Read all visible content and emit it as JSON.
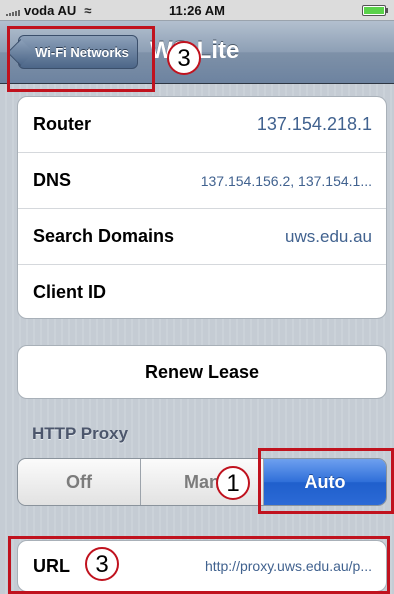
{
  "statusbar": {
    "carrier": "voda AU",
    "time": "11:26 AM"
  },
  "navbar": {
    "back_label": "Wi-Fi Networks",
    "title": "WS-Lite"
  },
  "rows": [
    {
      "label": "Router",
      "value": "137.154.218.1"
    },
    {
      "label": "DNS",
      "value": "137.154.156.2, 137.154.1..."
    },
    {
      "label": "Search Domains",
      "value": "uws.edu.au"
    },
    {
      "label": "Client ID",
      "value": ""
    }
  ],
  "renew_label": "Renew Lease",
  "proxy": {
    "header": "HTTP Proxy",
    "options": [
      "Off",
      "Man",
      "Auto"
    ],
    "selected": "Auto"
  },
  "url": {
    "label": "URL",
    "value": "http://proxy.uws.edu.au/p..."
  },
  "annotations": {
    "callout_back": "3",
    "callout_auto": "1",
    "callout_url": "3"
  },
  "colors": {
    "highlight": "#c0121e",
    "selected_segment": "#2f6fd9",
    "value_text": "#41628f"
  }
}
